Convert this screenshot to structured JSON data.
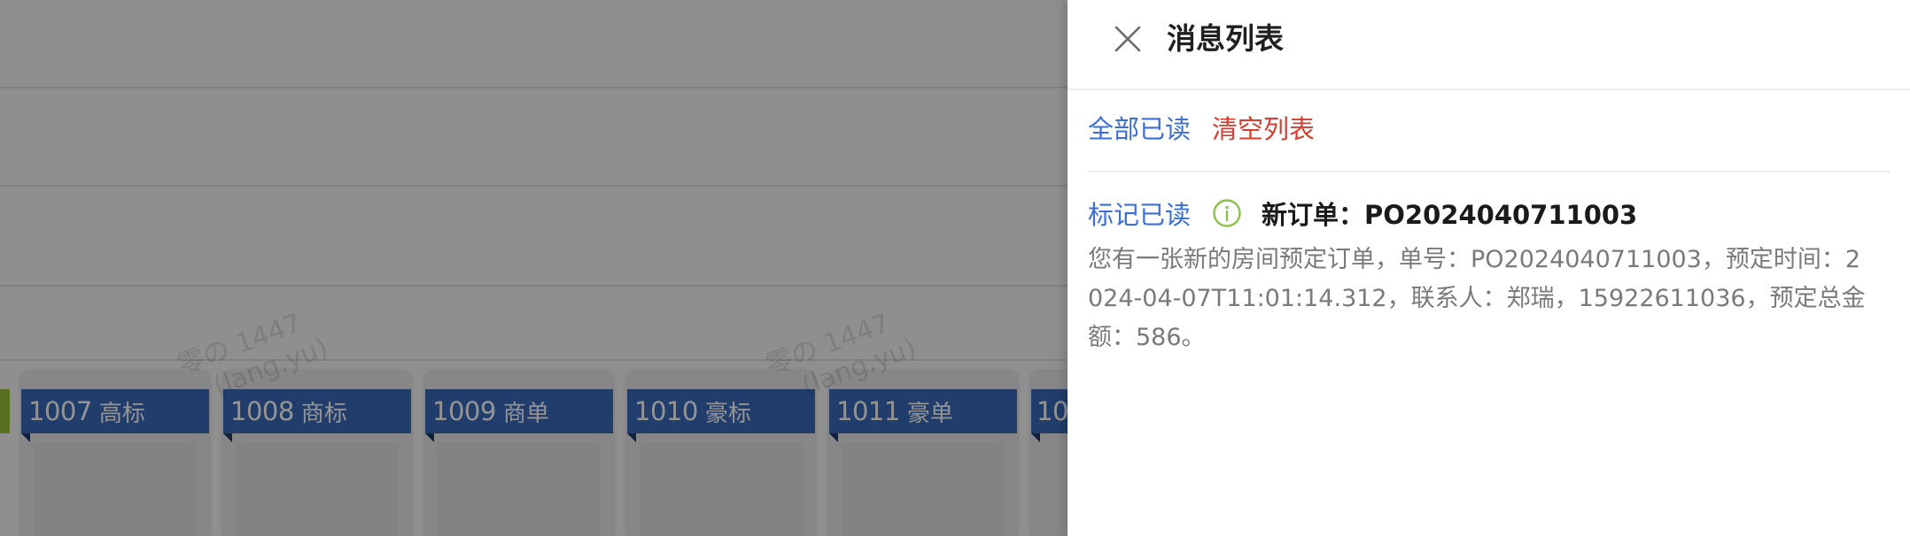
{
  "drawer": {
    "title": "消息列表",
    "actions": {
      "mark_all_read": "全部已读",
      "clear_list": "清空列表"
    },
    "message": {
      "mark_read": "标记已读",
      "icon": "info-icon",
      "title": "新订单：PO2024040711003",
      "body": "您有一张新的房间预定订单，单号：PO2024040711003，预定时间：2024-04-07T11:01:14.312，联系人：郑瑞，15922611036，预定总金额：586。"
    }
  },
  "background": {
    "rooms": [
      {
        "number": "1007",
        "type": "高标"
      },
      {
        "number": "1008",
        "type": "商标"
      },
      {
        "number": "1009",
        "type": "商单"
      },
      {
        "number": "1010",
        "type": "豪标"
      },
      {
        "number": "1011",
        "type": "豪单"
      },
      {
        "number": "10",
        "type": ""
      }
    ],
    "watermarks": [
      {
        "line1": "零の 1447",
        "line2": "(lang.yu)"
      },
      {
        "line1": "零の 1447",
        "line2": "(lang.yu)"
      }
    ]
  },
  "colors": {
    "link_blue": "#3b6fd8",
    "danger_red": "#d43d30",
    "room_tag_blue": "#3a69b8",
    "info_green": "#8cc24a"
  }
}
